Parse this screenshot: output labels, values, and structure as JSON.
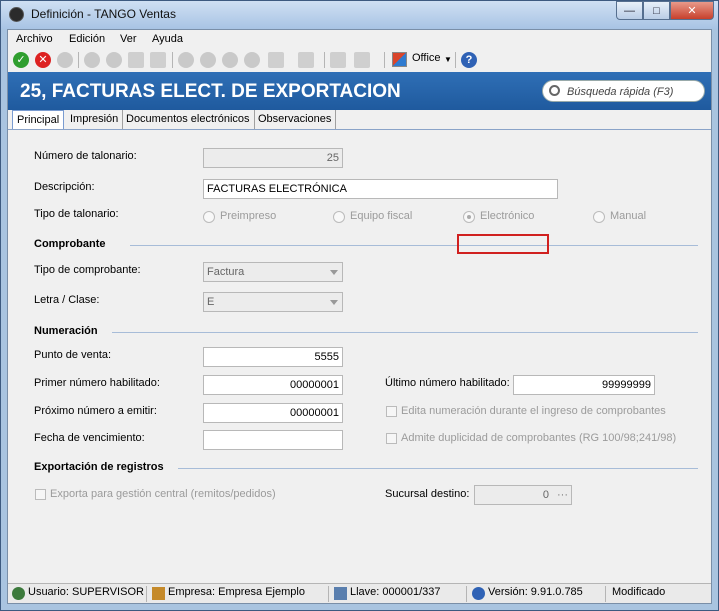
{
  "window": {
    "title": "Definición - TANGO Ventas"
  },
  "menu": {
    "archivo": "Archivo",
    "edicion": "Edición",
    "ver": "Ver",
    "ayuda": "Ayuda"
  },
  "toolbar": {
    "office_label": "Office"
  },
  "header": {
    "title": "25, FACTURAS ELECT. DE EXPORTACION",
    "search_placeholder": "Búsqueda rápida (F3)"
  },
  "tabs": [
    "Principal",
    "Impresión",
    "Documentos electrónicos",
    "Observaciones"
  ],
  "form": {
    "numero_talonario_label": "Número de talonario:",
    "numero_talonario_value": "25",
    "descripcion_label": "Descripción:",
    "descripcion_value": "FACTURAS ELECTRÓNICA",
    "tipo_talonario_label": "Tipo de talonario:",
    "tipo_options": [
      "Preimpreso",
      "Equipo fiscal",
      "Electrónico",
      "Manual"
    ],
    "tipo_selected": "Electrónico",
    "comprobante_section": "Comprobante",
    "tipo_comprobante_label": "Tipo de comprobante:",
    "tipo_comprobante_value": "Factura",
    "letra_clase_label": "Letra / Clase:",
    "letra_clase_value": "E",
    "numeracion_section": "Numeración",
    "punto_venta_label": "Punto de venta:",
    "punto_venta_value": "5555",
    "primer_numero_label": "Primer número habilitado:",
    "primer_numero_value": "00000001",
    "ultimo_numero_label": "Último número habilitado:",
    "ultimo_numero_value": "99999999",
    "proximo_numero_label": "Próximo número a emitir:",
    "proximo_numero_value": "00000001",
    "edita_numeracion_label": "Edita numeración durante el ingreso de comprobantes",
    "fecha_vencimiento_label": "Fecha de vencimiento:",
    "fecha_vencimiento_value": "",
    "admite_duplicidad_label": "Admite duplicidad de comprobantes (RG 100/98;241/98)",
    "exportacion_section": "Exportación de registros",
    "exporta_label": "Exporta para gestión central (remitos/pedidos)",
    "sucursal_destino_label": "Sucursal destino:",
    "sucursal_destino_value": "0"
  },
  "status": {
    "usuario": "Usuario: SUPERVISOR",
    "empresa": "Empresa: Empresa Ejemplo",
    "llave": "Llave: 000001/337",
    "version": "Versión: 9.91.0.785",
    "estado": "Modificado"
  }
}
